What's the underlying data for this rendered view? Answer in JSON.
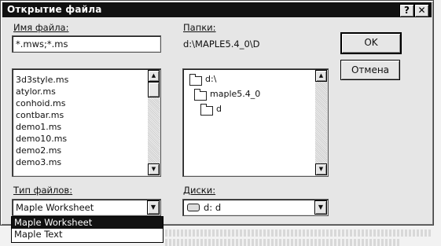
{
  "dialog": {
    "title": "Открытие файла",
    "help_button": "?",
    "close_button": "✕"
  },
  "filename": {
    "label": "Имя файла:",
    "value": "*.mws;*.ms",
    "files": [
      "3d3style.ms",
      "atylor.ms",
      "conhoid.ms",
      "contbar.ms",
      "demo1.ms",
      "demo10.ms",
      "demo2.ms",
      "demo3.ms"
    ]
  },
  "folders": {
    "label": "Папки:",
    "current_path": "d:\\MAPLE5.4_0\\D",
    "tree": [
      {
        "name": "d:\\"
      },
      {
        "name": "maple5.4_0"
      },
      {
        "name": "d"
      }
    ]
  },
  "buttons": {
    "ok": "OK",
    "cancel": "Отмена"
  },
  "filetype": {
    "label": "Тип файлов:",
    "selected": "Maple Worksheet",
    "options": [
      "Maple Worksheet",
      "Maple Text"
    ]
  },
  "drives": {
    "label": "Диски:",
    "selected": "d: d"
  }
}
